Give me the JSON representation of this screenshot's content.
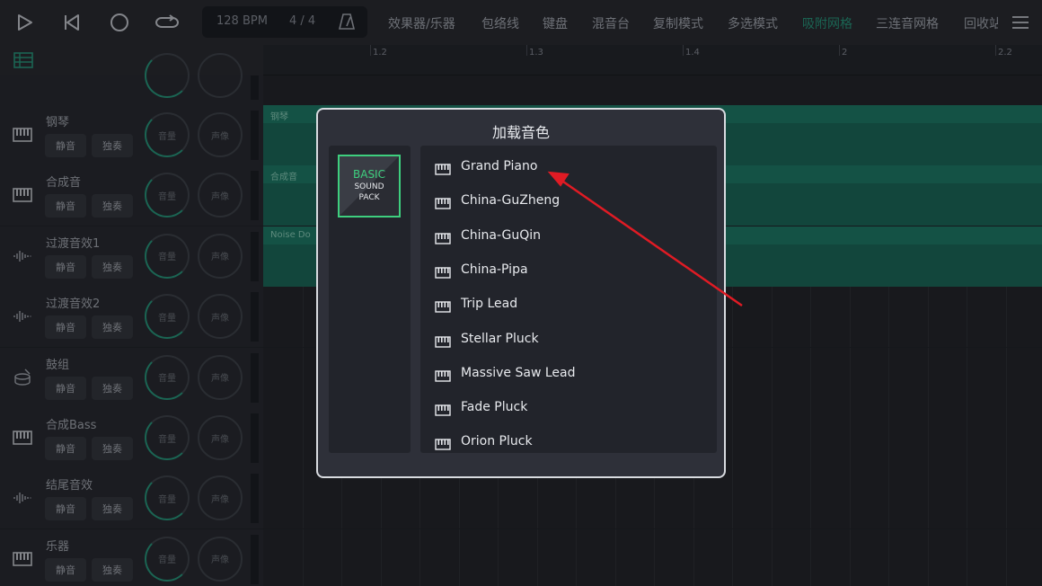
{
  "toolbar": {
    "bpm": "128 BPM",
    "time_signature": "4 / 4",
    "menu": [
      "效果器/乐器",
      "包络线",
      "键盘",
      "混音台",
      "复制模式",
      "多选模式",
      "吸附网格",
      "三连音网格",
      "回收站"
    ],
    "active_menu": "吸附网格"
  },
  "ruler": {
    "ticks": [
      "1.2",
      "1.3",
      "1.4",
      "2",
      "2.2"
    ]
  },
  "track_controls": {
    "mute": "静音",
    "solo": "独奏",
    "volume": "音量",
    "pan": "声像"
  },
  "tracks": [
    {
      "name": "钢琴",
      "icon": "piano-icon",
      "clip": "钢琴"
    },
    {
      "name": "合成音",
      "icon": "piano-icon",
      "clip": "合成音"
    },
    {
      "name": "过渡音效1",
      "icon": "waveform-icon",
      "clip": "Noise Do"
    },
    {
      "name": "过渡音效2",
      "icon": "waveform-icon",
      "clip": ""
    },
    {
      "name": "鼓组",
      "icon": "drum-icon",
      "clip": ""
    },
    {
      "name": "合成Bass",
      "icon": "piano-icon",
      "clip": ""
    },
    {
      "name": "结尾音效",
      "icon": "waveform-icon",
      "clip": ""
    },
    {
      "name": "乐器",
      "icon": "piano-icon",
      "clip": ""
    }
  ],
  "dialog": {
    "title": "加载音色",
    "pack": {
      "line1": "BASIC",
      "line2": "SOUND",
      "line3": "PACK"
    },
    "sounds": [
      "Grand Piano",
      "China-GuZheng",
      "China-GuQin",
      "China-Pipa",
      "Trip Lead",
      "Stellar Pluck",
      "Massive Saw Lead",
      "Fade Pluck",
      "Orion Pluck"
    ]
  },
  "colors": {
    "accent": "#2a9b80",
    "clip": "#1c6c5c",
    "pack_border": "#3ecf7e",
    "annotation_arrow": "#e01b24"
  }
}
